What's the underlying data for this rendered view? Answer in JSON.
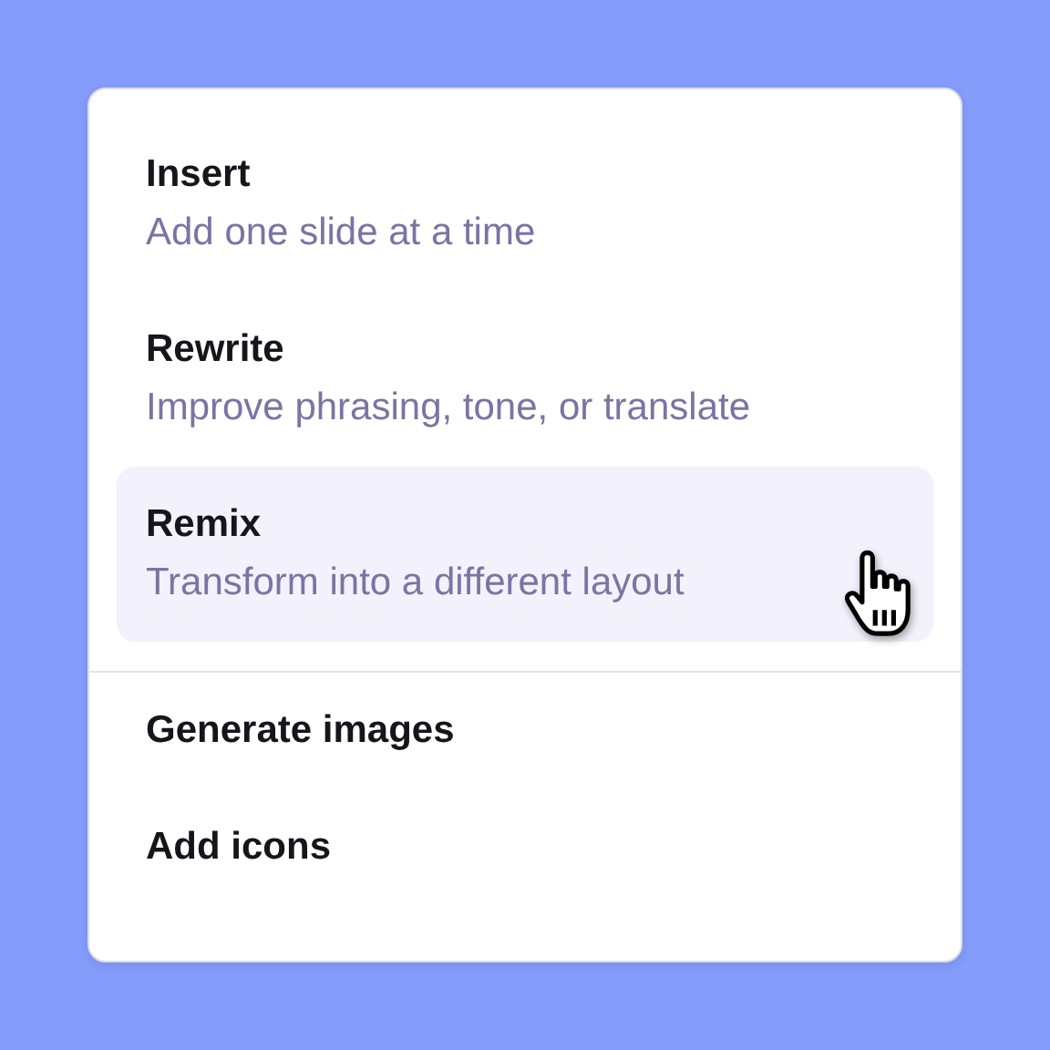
{
  "menu": {
    "items": [
      {
        "kind": "detailed",
        "title": "Insert",
        "description": "Add one slide at a time",
        "selected": false
      },
      {
        "kind": "detailed",
        "title": "Rewrite",
        "description": "Improve phrasing, tone, or translate",
        "selected": false
      },
      {
        "kind": "detailed",
        "title": "Remix",
        "description": "Transform into a different layout",
        "selected": true
      },
      {
        "kind": "divider"
      },
      {
        "kind": "simple",
        "title": "Generate images",
        "selected": false
      },
      {
        "kind": "simple",
        "title": "Add icons",
        "selected": false
      }
    ]
  }
}
